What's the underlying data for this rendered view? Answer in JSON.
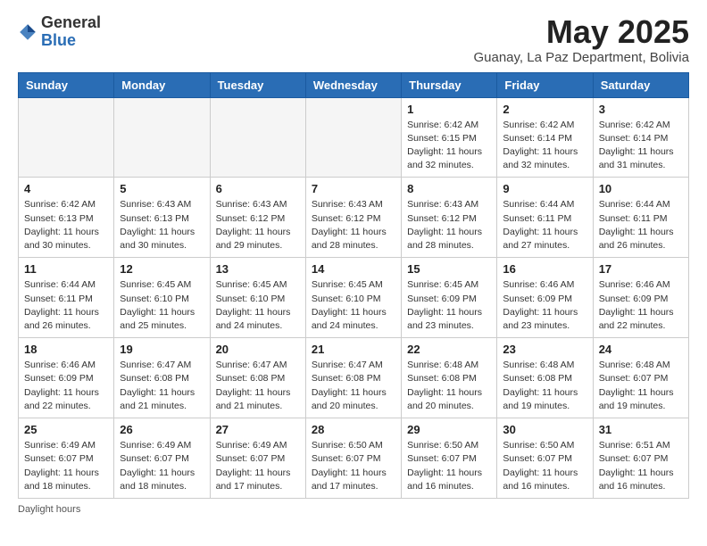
{
  "logo": {
    "general": "General",
    "blue": "Blue"
  },
  "title": "May 2025",
  "location": "Guanay, La Paz Department, Bolivia",
  "days_of_week": [
    "Sunday",
    "Monday",
    "Tuesday",
    "Wednesday",
    "Thursday",
    "Friday",
    "Saturday"
  ],
  "footer": "Daylight hours",
  "weeks": [
    [
      {
        "day": "",
        "info": ""
      },
      {
        "day": "",
        "info": ""
      },
      {
        "day": "",
        "info": ""
      },
      {
        "day": "",
        "info": ""
      },
      {
        "day": "1",
        "info": "Sunrise: 6:42 AM\nSunset: 6:15 PM\nDaylight: 11 hours and 32 minutes."
      },
      {
        "day": "2",
        "info": "Sunrise: 6:42 AM\nSunset: 6:14 PM\nDaylight: 11 hours and 32 minutes."
      },
      {
        "day": "3",
        "info": "Sunrise: 6:42 AM\nSunset: 6:14 PM\nDaylight: 11 hours and 31 minutes."
      }
    ],
    [
      {
        "day": "4",
        "info": "Sunrise: 6:42 AM\nSunset: 6:13 PM\nDaylight: 11 hours and 30 minutes."
      },
      {
        "day": "5",
        "info": "Sunrise: 6:43 AM\nSunset: 6:13 PM\nDaylight: 11 hours and 30 minutes."
      },
      {
        "day": "6",
        "info": "Sunrise: 6:43 AM\nSunset: 6:12 PM\nDaylight: 11 hours and 29 minutes."
      },
      {
        "day": "7",
        "info": "Sunrise: 6:43 AM\nSunset: 6:12 PM\nDaylight: 11 hours and 28 minutes."
      },
      {
        "day": "8",
        "info": "Sunrise: 6:43 AM\nSunset: 6:12 PM\nDaylight: 11 hours and 28 minutes."
      },
      {
        "day": "9",
        "info": "Sunrise: 6:44 AM\nSunset: 6:11 PM\nDaylight: 11 hours and 27 minutes."
      },
      {
        "day": "10",
        "info": "Sunrise: 6:44 AM\nSunset: 6:11 PM\nDaylight: 11 hours and 26 minutes."
      }
    ],
    [
      {
        "day": "11",
        "info": "Sunrise: 6:44 AM\nSunset: 6:11 PM\nDaylight: 11 hours and 26 minutes."
      },
      {
        "day": "12",
        "info": "Sunrise: 6:45 AM\nSunset: 6:10 PM\nDaylight: 11 hours and 25 minutes."
      },
      {
        "day": "13",
        "info": "Sunrise: 6:45 AM\nSunset: 6:10 PM\nDaylight: 11 hours and 24 minutes."
      },
      {
        "day": "14",
        "info": "Sunrise: 6:45 AM\nSunset: 6:10 PM\nDaylight: 11 hours and 24 minutes."
      },
      {
        "day": "15",
        "info": "Sunrise: 6:45 AM\nSunset: 6:09 PM\nDaylight: 11 hours and 23 minutes."
      },
      {
        "day": "16",
        "info": "Sunrise: 6:46 AM\nSunset: 6:09 PM\nDaylight: 11 hours and 23 minutes."
      },
      {
        "day": "17",
        "info": "Sunrise: 6:46 AM\nSunset: 6:09 PM\nDaylight: 11 hours and 22 minutes."
      }
    ],
    [
      {
        "day": "18",
        "info": "Sunrise: 6:46 AM\nSunset: 6:09 PM\nDaylight: 11 hours and 22 minutes."
      },
      {
        "day": "19",
        "info": "Sunrise: 6:47 AM\nSunset: 6:08 PM\nDaylight: 11 hours and 21 minutes."
      },
      {
        "day": "20",
        "info": "Sunrise: 6:47 AM\nSunset: 6:08 PM\nDaylight: 11 hours and 21 minutes."
      },
      {
        "day": "21",
        "info": "Sunrise: 6:47 AM\nSunset: 6:08 PM\nDaylight: 11 hours and 20 minutes."
      },
      {
        "day": "22",
        "info": "Sunrise: 6:48 AM\nSunset: 6:08 PM\nDaylight: 11 hours and 20 minutes."
      },
      {
        "day": "23",
        "info": "Sunrise: 6:48 AM\nSunset: 6:08 PM\nDaylight: 11 hours and 19 minutes."
      },
      {
        "day": "24",
        "info": "Sunrise: 6:48 AM\nSunset: 6:07 PM\nDaylight: 11 hours and 19 minutes."
      }
    ],
    [
      {
        "day": "25",
        "info": "Sunrise: 6:49 AM\nSunset: 6:07 PM\nDaylight: 11 hours and 18 minutes."
      },
      {
        "day": "26",
        "info": "Sunrise: 6:49 AM\nSunset: 6:07 PM\nDaylight: 11 hours and 18 minutes."
      },
      {
        "day": "27",
        "info": "Sunrise: 6:49 AM\nSunset: 6:07 PM\nDaylight: 11 hours and 17 minutes."
      },
      {
        "day": "28",
        "info": "Sunrise: 6:50 AM\nSunset: 6:07 PM\nDaylight: 11 hours and 17 minutes."
      },
      {
        "day": "29",
        "info": "Sunrise: 6:50 AM\nSunset: 6:07 PM\nDaylight: 11 hours and 16 minutes."
      },
      {
        "day": "30",
        "info": "Sunrise: 6:50 AM\nSunset: 6:07 PM\nDaylight: 11 hours and 16 minutes."
      },
      {
        "day": "31",
        "info": "Sunrise: 6:51 AM\nSunset: 6:07 PM\nDaylight: 11 hours and 16 minutes."
      }
    ]
  ]
}
